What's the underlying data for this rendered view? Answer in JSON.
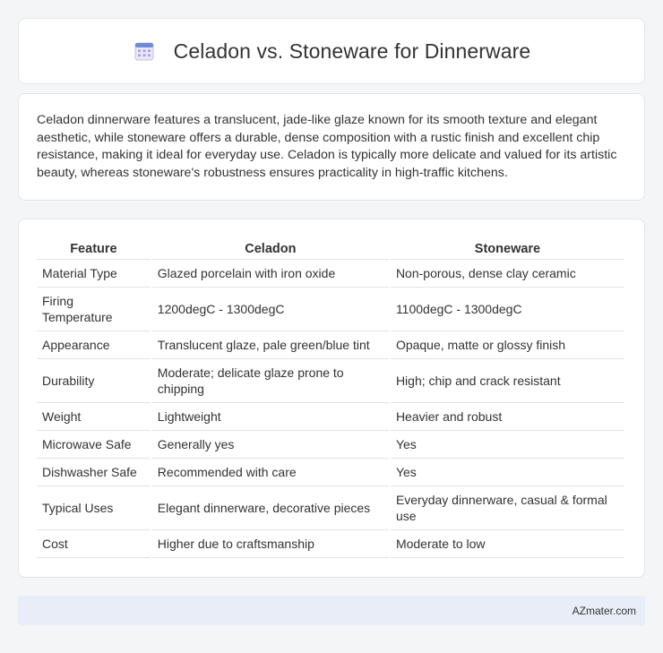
{
  "header": {
    "icon": "calendar-icon",
    "title": "Celadon vs. Stoneware for Dinnerware"
  },
  "intro": {
    "text": "Celadon dinnerware features a translucent, jade-like glaze known for its smooth texture and elegant aesthetic, while stoneware offers a durable, dense composition with a rustic finish and excellent chip resistance, making it ideal for everyday use. Celadon is typically more delicate and valued for its artistic beauty, whereas stoneware's robustness ensures practicality in high-traffic kitchens."
  },
  "table": {
    "headers": [
      "Feature",
      "Celadon",
      "Stoneware"
    ],
    "rows": [
      [
        "Material Type",
        "Glazed porcelain with iron oxide",
        "Non-porous, dense clay ceramic"
      ],
      [
        "Firing Temperature",
        "1200degC - 1300degC",
        "1100degC - 1300degC"
      ],
      [
        "Appearance",
        "Translucent glaze, pale green/blue tint",
        "Opaque, matte or glossy finish"
      ],
      [
        "Durability",
        "Moderate; delicate glaze prone to chipping",
        "High; chip and crack resistant"
      ],
      [
        "Weight",
        "Lightweight",
        "Heavier and robust"
      ],
      [
        "Microwave Safe",
        "Generally yes",
        "Yes"
      ],
      [
        "Dishwasher Safe",
        "Recommended with care",
        "Yes"
      ],
      [
        "Typical Uses",
        "Elegant dinnerware, decorative pieces",
        "Everyday dinnerware, casual & formal use"
      ],
      [
        "Cost",
        "Higher due to craftsmanship",
        "Moderate to low"
      ]
    ]
  },
  "footer": {
    "brand": "AZmater.com"
  }
}
